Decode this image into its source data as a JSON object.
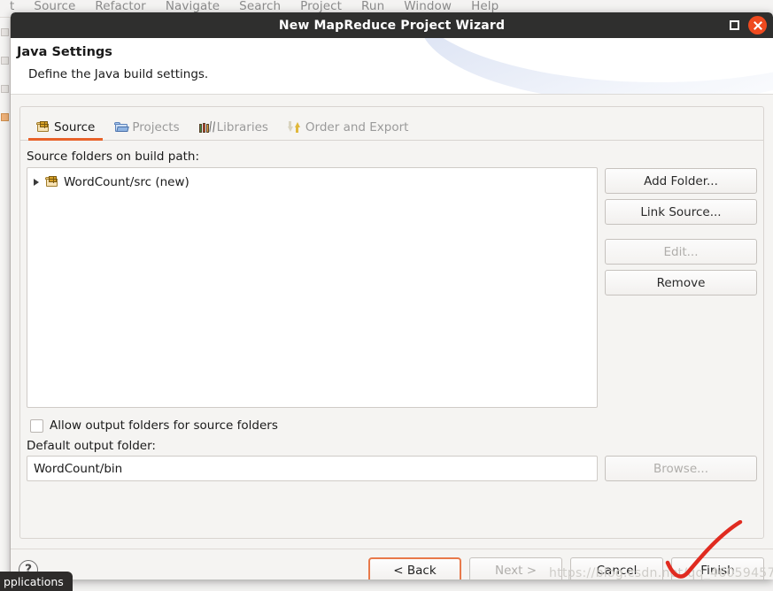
{
  "background_app": {
    "menus": [
      "t",
      "Source",
      "Refactor",
      "Navigate",
      "Search",
      "Project",
      "Run",
      "Window",
      "Help"
    ]
  },
  "dialog": {
    "title": "New MapReduce Project Wizard",
    "maximize_icon": "maximize-icon",
    "close_icon": "close-icon",
    "header": {
      "title": "Java Settings",
      "subtitle": "Define the Java build settings."
    },
    "tabs": [
      {
        "label": "Source",
        "icon": "source-folder-icon",
        "active": true
      },
      {
        "label": "Projects",
        "icon": "projects-folder-icon",
        "active": false
      },
      {
        "label": "Libraries",
        "icon": "libraries-books-icon",
        "active": false
      },
      {
        "label": "Order and Export",
        "icon": "order-export-arrows-icon",
        "active": false
      }
    ],
    "source_section": {
      "label": "Source folders on build path:",
      "tree_items": [
        {
          "label": "WordCount/src (new)",
          "icon": "source-folder-icon",
          "expand_icon": "chevron-right-icon"
        }
      ],
      "buttons": [
        {
          "label": "Add Folder...",
          "enabled": true
        },
        {
          "label": "Link Source...",
          "enabled": true
        },
        {
          "label": "Edit...",
          "enabled": false
        },
        {
          "label": "Remove",
          "enabled": true
        }
      ]
    },
    "allow_output_checkbox": {
      "label": "Allow output folders for source folders",
      "checked": false
    },
    "default_output": {
      "label": "Default output folder:",
      "value": "WordCount/bin",
      "placeholder": "",
      "browse_label": "Browse...",
      "browse_enabled": false
    },
    "footer": {
      "help_icon": "help-question-icon",
      "help_label": "?",
      "buttons": [
        {
          "label": "< Back",
          "enabled": true,
          "focused": true
        },
        {
          "label": "Next >",
          "enabled": false,
          "focused": false
        },
        {
          "label": "Cancel",
          "enabled": true,
          "focused": false
        },
        {
          "label": "Finish",
          "enabled": true,
          "focused": false
        }
      ]
    }
  },
  "overlays": {
    "watermark": "https://blog.csdn.net/qq_46059457",
    "annotation_icon": "red-check-annotation",
    "taskbar_chip": "pplications"
  },
  "colors": {
    "titlebar": "#2f2f2e",
    "close_button": "#ef4a1f",
    "accent_orange": "#e8622a",
    "focus_orange": "#e8794a",
    "panel_bg": "#f5f4f2",
    "annotation_red": "#e02b20"
  }
}
